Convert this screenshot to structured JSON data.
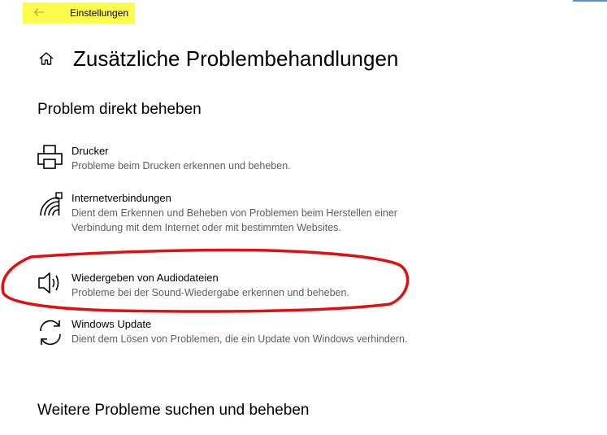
{
  "window": {
    "title": "Einstellungen"
  },
  "page": {
    "title": "Zusätzliche Problembehandlungen"
  },
  "sections": {
    "direct": "Problem direkt beheben",
    "more": "Weitere Probleme suchen und beheben"
  },
  "items": [
    {
      "name": "Drucker",
      "description": "Probleme beim Drucken erkennen und beheben.",
      "icon": "printer-icon"
    },
    {
      "name": "Internetverbindungen",
      "description": "Dient dem Erkennen und Beheben von Problemen beim Herstellen einer Verbindung mit dem Internet oder mit bestimmten Websites.",
      "icon": "network-icon"
    },
    {
      "name": "Wiedergeben von Audiodateien",
      "description": "Probleme bei der Sound-Wiedergabe erkennen und beheben.",
      "icon": "speaker-icon"
    },
    {
      "name": "Windows Update",
      "description": "Dient dem Lösen von Problemen, die ein Update von Windows verhindern.",
      "icon": "refresh-icon"
    }
  ],
  "colors": {
    "highlight": "#fffb4d",
    "annotation": "#e01010",
    "description_text": "#5d5d5d"
  }
}
